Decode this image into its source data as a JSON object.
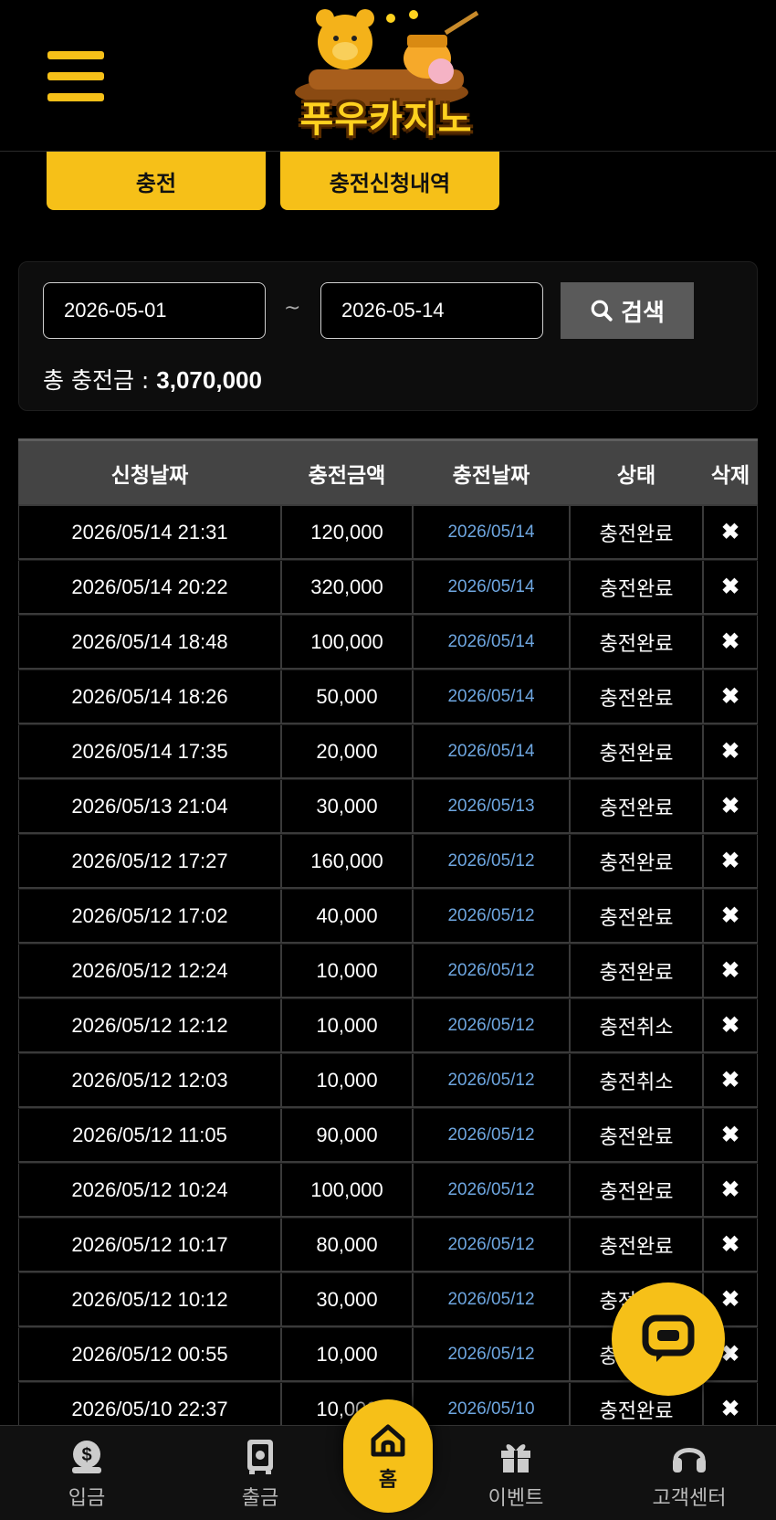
{
  "header": {
    "logo_text": "푸우카지노"
  },
  "tabs": [
    {
      "label": "충전"
    },
    {
      "label": "충전신청내역"
    }
  ],
  "search": {
    "date_from": "2026-05-01",
    "separator": "~",
    "date_to": "2026-05-14",
    "button_label": "검색",
    "total_label": "총 충전금 :",
    "total_value": "3,070,000"
  },
  "table": {
    "headers": [
      "신청날짜",
      "충전금액",
      "충전날짜",
      "상태",
      "삭제"
    ],
    "delete_symbol": "✖",
    "rows": [
      {
        "requested": "2026/05/14 21:31",
        "amount": "120,000",
        "paid": "2026/05/14",
        "status": "충전완료"
      },
      {
        "requested": "2026/05/14 20:22",
        "amount": "320,000",
        "paid": "2026/05/14",
        "status": "충전완료"
      },
      {
        "requested": "2026/05/14 18:48",
        "amount": "100,000",
        "paid": "2026/05/14",
        "status": "충전완료"
      },
      {
        "requested": "2026/05/14 18:26",
        "amount": "50,000",
        "paid": "2026/05/14",
        "status": "충전완료"
      },
      {
        "requested": "2026/05/14 17:35",
        "amount": "20,000",
        "paid": "2026/05/14",
        "status": "충전완료"
      },
      {
        "requested": "2026/05/13 21:04",
        "amount": "30,000",
        "paid": "2026/05/13",
        "status": "충전완료"
      },
      {
        "requested": "2026/05/12 17:27",
        "amount": "160,000",
        "paid": "2026/05/12",
        "status": "충전완료"
      },
      {
        "requested": "2026/05/12 17:02",
        "amount": "40,000",
        "paid": "2026/05/12",
        "status": "충전완료"
      },
      {
        "requested": "2026/05/12 12:24",
        "amount": "10,000",
        "paid": "2026/05/12",
        "status": "충전완료"
      },
      {
        "requested": "2026/05/12 12:12",
        "amount": "10,000",
        "paid": "2026/05/12",
        "status": "충전취소"
      },
      {
        "requested": "2026/05/12 12:03",
        "amount": "10,000",
        "paid": "2026/05/12",
        "status": "충전취소"
      },
      {
        "requested": "2026/05/12 11:05",
        "amount": "90,000",
        "paid": "2026/05/12",
        "status": "충전완료"
      },
      {
        "requested": "2026/05/12 10:24",
        "amount": "100,000",
        "paid": "2026/05/12",
        "status": "충전완료"
      },
      {
        "requested": "2026/05/12 10:17",
        "amount": "80,000",
        "paid": "2026/05/12",
        "status": "충전완료"
      },
      {
        "requested": "2026/05/12 10:12",
        "amount": "30,000",
        "paid": "2026/05/12",
        "status": "충전완료"
      },
      {
        "requested": "2026/05/12 00:55",
        "amount": "10,000",
        "paid": "2026/05/12",
        "status": "충전완료"
      },
      {
        "requested": "2026/05/10 22:37",
        "amount": "10,000",
        "paid": "2026/05/10",
        "status": "충전완료"
      }
    ]
  },
  "bottom_nav": {
    "deposit": "입금",
    "withdraw": "출금",
    "home": "홈",
    "event": "이벤트",
    "support": "고객센터"
  },
  "colors": {
    "accent": "#f6c018",
    "paid_date": "#6ea6e0",
    "header_row": "#444444"
  }
}
